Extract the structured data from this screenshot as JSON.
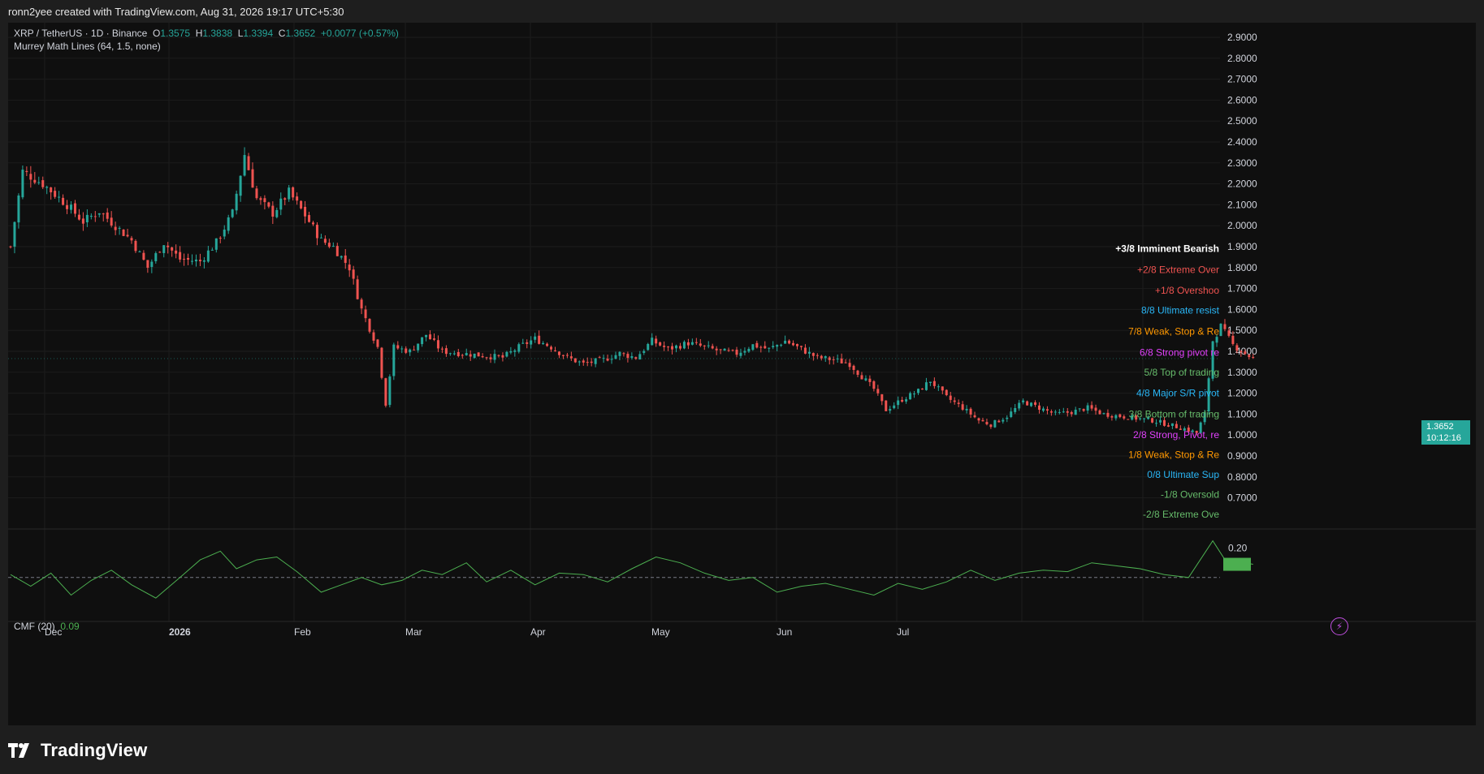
{
  "credit": "ronn2yee created with TradingView.com, Aug 31, 2026 19:17 UTC+5:30",
  "legend": {
    "symbol": "XRP / TetherUS · 1D · Binance",
    "o_label": "O",
    "o_value": "1.3575",
    "h_label": "H",
    "h_value": "1.3838",
    "l_label": "L",
    "l_value": "1.3394",
    "c_label": "C",
    "c_value": "1.3652",
    "change": "+0.0077 (+0.57%)",
    "indicator": "Murrey Math Lines (64, 1.5, none)"
  },
  "cmf_legend": {
    "name": "CMF (20)",
    "value": "0.09"
  },
  "price_tag": {
    "price": "1.3652",
    "countdown": "10:12:16"
  },
  "footer": {
    "brand": "TradingView"
  },
  "colors": {
    "up": "#26a69a",
    "down": "#ef5350",
    "cmf": "#4caf50",
    "bg": "#0f0f0f"
  },
  "chart_data": {
    "type": "candlestick",
    "symbol": "XRP / TetherUS",
    "timeframe": "1D",
    "exchange": "Binance",
    "x_labels": [
      "Dec",
      "2026",
      "Feb",
      "Mar",
      "Apr",
      "May",
      "Jun",
      "Jul"
    ],
    "y_ticks": [
      "2.9000",
      "2.8000",
      "2.7000",
      "2.6000",
      "2.5000",
      "2.4000",
      "2.3000",
      "2.2000",
      "2.1000",
      "2.0000",
      "1.9000",
      "1.8000",
      "1.7000",
      "1.6000",
      "1.5000",
      "1.4000",
      "1.3000",
      "1.2000",
      "1.1000",
      "1.0000",
      "0.9000",
      "0.8000",
      "0.7000"
    ],
    "ylim": [
      0.65,
      2.95
    ],
    "close_path": [
      [
        0,
        1.9
      ],
      [
        3,
        2.26
      ],
      [
        8,
        2.2
      ],
      [
        14,
        2.1
      ],
      [
        18,
        2.02
      ],
      [
        22,
        2.07
      ],
      [
        26,
        2.0
      ],
      [
        30,
        1.93
      ],
      [
        34,
        1.8
      ],
      [
        38,
        1.92
      ],
      [
        42,
        1.84
      ],
      [
        47,
        1.83
      ],
      [
        51,
        1.92
      ],
      [
        55,
        2.06
      ],
      [
        58,
        2.34
      ],
      [
        61,
        2.13
      ],
      [
        65,
        2.06
      ],
      [
        69,
        2.16
      ],
      [
        73,
        2.05
      ],
      [
        77,
        1.93
      ],
      [
        80,
        1.9
      ],
      [
        84,
        1.8
      ],
      [
        87,
        1.6
      ],
      [
        91,
        1.42
      ],
      [
        93,
        1.15
      ],
      [
        95,
        1.42
      ],
      [
        99,
        1.4
      ],
      [
        103,
        1.48
      ],
      [
        107,
        1.4
      ],
      [
        112,
        1.39
      ],
      [
        117,
        1.38
      ],
      [
        122,
        1.37
      ],
      [
        126,
        1.42
      ],
      [
        130,
        1.46
      ],
      [
        134,
        1.42
      ],
      [
        138,
        1.37
      ],
      [
        142,
        1.34
      ],
      [
        147,
        1.36
      ],
      [
        151,
        1.39
      ],
      [
        155,
        1.37
      ],
      [
        159,
        1.45
      ],
      [
        163,
        1.41
      ],
      [
        168,
        1.44
      ],
      [
        172,
        1.42
      ],
      [
        176,
        1.4
      ],
      [
        180,
        1.39
      ],
      [
        184,
        1.43
      ],
      [
        188,
        1.41
      ],
      [
        192,
        1.45
      ],
      [
        196,
        1.41
      ],
      [
        200,
        1.37
      ],
      [
        204,
        1.36
      ],
      [
        208,
        1.34
      ],
      [
        210,
        1.3
      ],
      [
        214,
        1.22
      ],
      [
        217,
        1.12
      ],
      [
        221,
        1.17
      ],
      [
        225,
        1.21
      ],
      [
        228,
        1.26
      ],
      [
        232,
        1.18
      ],
      [
        236,
        1.13
      ],
      [
        240,
        1.07
      ],
      [
        243,
        1.05
      ],
      [
        247,
        1.09
      ],
      [
        251,
        1.16
      ],
      [
        255,
        1.13
      ],
      [
        259,
        1.1
      ],
      [
        263,
        1.11
      ],
      [
        267,
        1.13
      ],
      [
        271,
        1.1
      ],
      [
        275,
        1.09
      ],
      [
        279,
        1.08
      ],
      [
        283,
        1.07
      ],
      [
        287,
        1.05
      ],
      [
        291,
        1.03
      ],
      [
        294,
        1.01
      ],
      [
        296,
        1.1
      ],
      [
        298,
        1.45
      ],
      [
        300,
        1.52
      ],
      [
        303,
        1.43
      ],
      [
        306,
        1.39
      ],
      [
        308,
        1.365
      ]
    ],
    "murrey_math_lines": [
      {
        "label": "+3/8 Imminent Bearish",
        "price": 1.89,
        "color": "#ffffff"
      },
      {
        "label": "+2/8 Extreme Over",
        "price": 1.79,
        "color": "#ef5350"
      },
      {
        "label": "+1/8 Overshoo",
        "price": 1.69,
        "color": "#ef5350"
      },
      {
        "label": "8/8 Ultimate resist",
        "price": 1.595,
        "color": "#29b6f6"
      },
      {
        "label": "7/8 Weak, Stop & Re",
        "price": 1.495,
        "color": "#ff9800"
      },
      {
        "label": "6/8 Strong pivot re",
        "price": 1.395,
        "color": "#e040fb"
      },
      {
        "label": "5/8 Top of trading",
        "price": 1.3,
        "color": "#66bb6a"
      },
      {
        "label": "4/8 Major S/R pivot",
        "price": 1.2,
        "color": "#29b6f6"
      },
      {
        "label": "3/8 Bottom of trading",
        "price": 1.1,
        "color": "#66bb6a"
      },
      {
        "label": "2/8 Strong, Pivot, re",
        "price": 1.0,
        "color": "#e040fb"
      },
      {
        "label": "1/8 Weak, Stop & Re",
        "price": 0.905,
        "color": "#ff9800"
      },
      {
        "label": "0/8 Ultimate Sup",
        "price": 0.81,
        "color": "#29b6f6"
      },
      {
        "label": "-1/8 Oversold",
        "price": 0.715,
        "color": "#66bb6a"
      },
      {
        "label": "-2/8 Extreme Ove",
        "price": 0.62,
        "color": "#66bb6a"
      }
    ],
    "cmf": {
      "name": "CMF (20)",
      "last": 0.09,
      "y_tick": "0.20",
      "ylim": [
        -0.3,
        0.32
      ],
      "path": [
        [
          0,
          0.02
        ],
        [
          5,
          -0.06
        ],
        [
          10,
          0.03
        ],
        [
          15,
          -0.12
        ],
        [
          20,
          -0.02
        ],
        [
          25,
          0.05
        ],
        [
          30,
          -0.05
        ],
        [
          36,
          -0.14
        ],
        [
          42,
          0.0
        ],
        [
          47,
          0.12
        ],
        [
          52,
          0.18
        ],
        [
          56,
          0.06
        ],
        [
          61,
          0.12
        ],
        [
          66,
          0.14
        ],
        [
          71,
          0.04
        ],
        [
          77,
          -0.1
        ],
        [
          82,
          -0.05
        ],
        [
          87,
          0.0
        ],
        [
          92,
          -0.05
        ],
        [
          97,
          -0.02
        ],
        [
          102,
          0.05
        ],
        [
          107,
          0.02
        ],
        [
          113,
          0.1
        ],
        [
          118,
          -0.03
        ],
        [
          124,
          0.05
        ],
        [
          130,
          -0.05
        ],
        [
          136,
          0.03
        ],
        [
          142,
          0.02
        ],
        [
          148,
          -0.03
        ],
        [
          154,
          0.06
        ],
        [
          160,
          0.14
        ],
        [
          166,
          0.1
        ],
        [
          172,
          0.03
        ],
        [
          178,
          -0.02
        ],
        [
          184,
          0.0
        ],
        [
          190,
          -0.1
        ],
        [
          196,
          -0.06
        ],
        [
          202,
          -0.04
        ],
        [
          208,
          -0.08
        ],
        [
          214,
          -0.12
        ],
        [
          220,
          -0.04
        ],
        [
          226,
          -0.08
        ],
        [
          232,
          -0.03
        ],
        [
          238,
          0.05
        ],
        [
          244,
          -0.02
        ],
        [
          250,
          0.03
        ],
        [
          256,
          0.05
        ],
        [
          262,
          0.04
        ],
        [
          268,
          0.1
        ],
        [
          274,
          0.08
        ],
        [
          280,
          0.06
        ],
        [
          286,
          0.02
        ],
        [
          292,
          0.0
        ],
        [
          298,
          0.25
        ],
        [
          302,
          0.08
        ],
        [
          306,
          0.1
        ],
        [
          308,
          0.09
        ]
      ]
    }
  }
}
